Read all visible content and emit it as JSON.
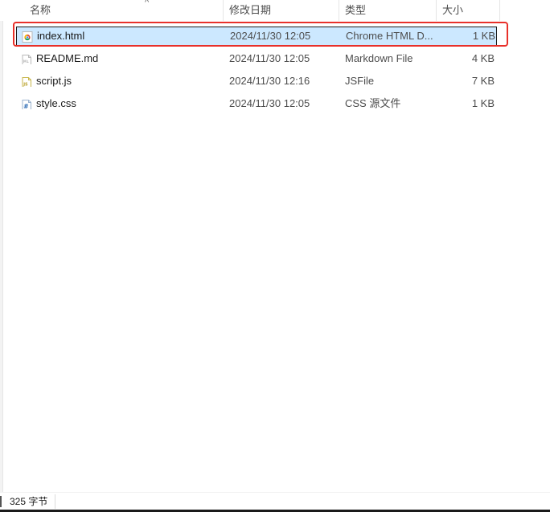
{
  "columns": {
    "name": "名称",
    "date": "修改日期",
    "type": "类型",
    "size": "大小"
  },
  "files": [
    {
      "name": "index.html",
      "date": "2024/11/30 12:05",
      "type": "Chrome HTML D...",
      "size": "1 KB",
      "icon": "chrome-html-icon"
    },
    {
      "name": "README.md",
      "date": "2024/11/30 12:05",
      "type": "Markdown File",
      "size": "4 KB",
      "icon": "markdown-file-icon"
    },
    {
      "name": "script.js",
      "date": "2024/11/30 12:16",
      "type": "JSFile",
      "size": "7 KB",
      "icon": "js-file-icon"
    },
    {
      "name": "style.css",
      "date": "2024/11/30 12:05",
      "type": "CSS 源文件",
      "size": "1 KB",
      "icon": "css-file-icon"
    }
  ],
  "status": {
    "text": "325 字节"
  },
  "colors": {
    "selection": "#cce8ff",
    "highlight": "#e8302a"
  }
}
